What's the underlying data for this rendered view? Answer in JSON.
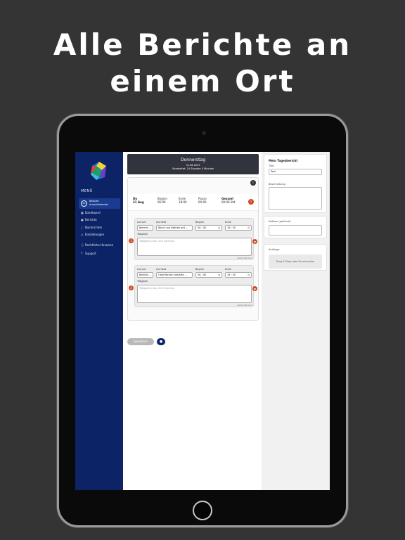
{
  "headline": {
    "line1": "Alle Berichte an",
    "line2": "einem Ort"
  },
  "sidebar": {
    "menu_title": "MENÜ",
    "user": {
      "initials": "BA",
      "name_line1": "Beispiel",
      "name_line2": "Auszubildender"
    },
    "items": [
      {
        "label": "Dashboard",
        "icon": "grid-icon"
      },
      {
        "label": "Berichte",
        "icon": "calendar-icon"
      },
      {
        "label": "Nachrichten",
        "icon": "chat-icon"
      },
      {
        "label": "Einstellungen",
        "icon": "user-icon"
      },
      {
        "label": "Rechtliche Hinweise",
        "icon": "info-icon"
      },
      {
        "label": "Support",
        "icon": "help-icon"
      }
    ]
  },
  "day": {
    "title": "Donnerstag",
    "date": "31.08.2023",
    "worked": "Gearbeitet: 24 Stunden 0 Minuten"
  },
  "summary": {
    "day_label": "Do",
    "date": "31 Aug",
    "begin_label": "Beginn",
    "begin": "06:00",
    "end_label": "Ende",
    "end": "18:00",
    "pause_label": "Pause",
    "pause": "00:00",
    "total_label": "Gesamt",
    "total": "00:00 Std.",
    "badge": "1"
  },
  "entries": [
    {
      "num": "1",
      "lernort_label": "Lernort",
      "lernort": "Betrieb",
      "lernfeld_label": "Lernfeld",
      "lernfeld": "Beruf und Betrieb prä",
      "begin_label": "Beginn",
      "begin": "06 : 00",
      "end_label": "Ende",
      "end": "18 : 00",
      "task_label": "Tätigkeit",
      "placeholder": "Tätigkeit (max. 200 Zeichen)",
      "count": "0/200 Zeichen"
    },
    {
      "num": "2",
      "lernort_label": "Lernort",
      "lernort": "Betrieb",
      "lernfeld_label": "Lernfeld",
      "lernfeld": "Oberflächen desinfizi",
      "begin_label": "Beginn",
      "begin": "06 : 00",
      "end_label": "Ende",
      "end": "18 : 00",
      "task_label": "Tätigkeit",
      "placeholder": "Tätigkeit (max. 200 Zeichen)",
      "count": "0/200 Zeichen"
    }
  ],
  "actions": {
    "save": "Speichern"
  },
  "report": {
    "title": "Mein Tagesbericht",
    "title_label": "Titel",
    "title_value": "Test",
    "desc_label": "Beschreibung",
    "notes_label": "Notizen (optional)",
    "attach_label": "Anhänge",
    "dropzone": "Drag & Drop oder Durchsuchen"
  },
  "colors": {
    "sidebar": "#0c2466",
    "header": "#32343d",
    "accent_red": "#cf4a21",
    "background": "#343434"
  }
}
